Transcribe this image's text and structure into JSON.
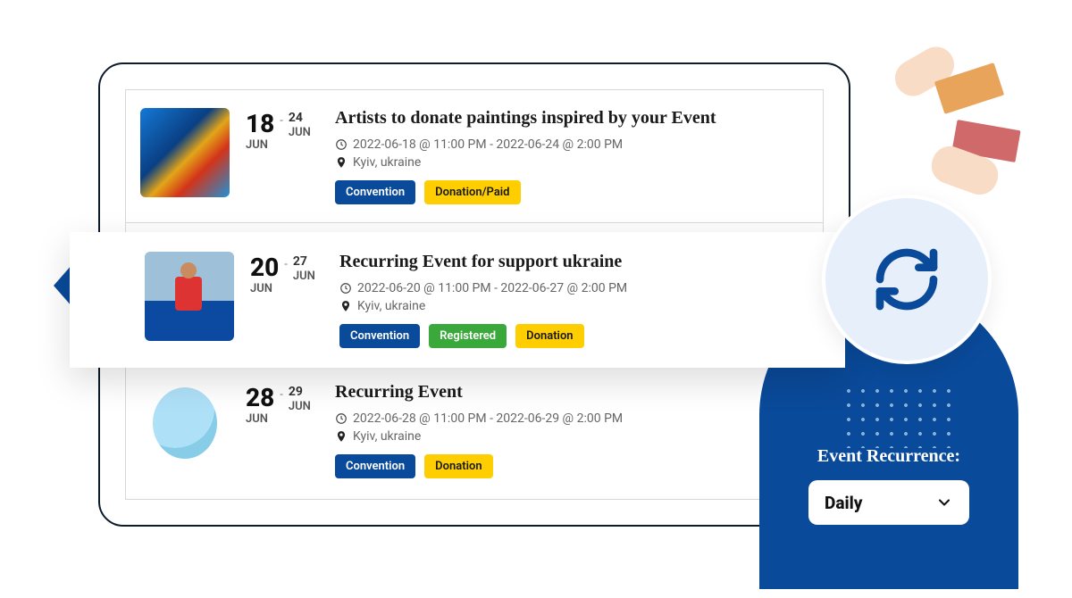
{
  "events": [
    {
      "img_name": "painting-thumb",
      "start_day": "18",
      "start_mon": "JUN",
      "end_day": "24",
      "end_mon": "JUN",
      "title": "Artists to donate paintings inspired by your Event",
      "datetime": "2022-06-18 @ 11:00 PM - 2022-06-24 @ 2:00 PM",
      "location": "Kyiv, ukraine",
      "tags": [
        "Convention",
        "Donation/Paid"
      ],
      "tag_styles": [
        "blue",
        "yellow"
      ]
    },
    {
      "img_name": "runner-thumb",
      "start_day": "20",
      "start_mon": "JUN",
      "end_day": "27",
      "end_mon": "JUN",
      "title": "Recurring Event for support ukraine",
      "datetime": "2022-06-20 @ 11:00 PM - 2022-06-27 @ 2:00 PM",
      "location": "Kyiv, ukraine",
      "tags": [
        "Convention",
        "Registered",
        "Donation"
      ],
      "tag_styles": [
        "blue",
        "green",
        "yellow"
      ]
    },
    {
      "img_name": "balloon-thumb",
      "start_day": "28",
      "start_mon": "JUN",
      "end_day": "29",
      "end_mon": "JUN",
      "title": "Recurring Event",
      "datetime": "2022-06-28 @ 11:00 PM - 2022-06-29 @ 2:00 PM",
      "location": "Kyiv, ukraine",
      "tags": [
        "Convention",
        "Donation"
      ],
      "tag_styles": [
        "blue",
        "yellow"
      ]
    }
  ],
  "recurrence": {
    "label": "Event Recurrence:",
    "selected": "Daily"
  },
  "icons": {
    "clock": "clock-icon",
    "pin": "location-pin-icon",
    "refresh": "refresh-icon",
    "chevron": "chevron-down-icon"
  }
}
